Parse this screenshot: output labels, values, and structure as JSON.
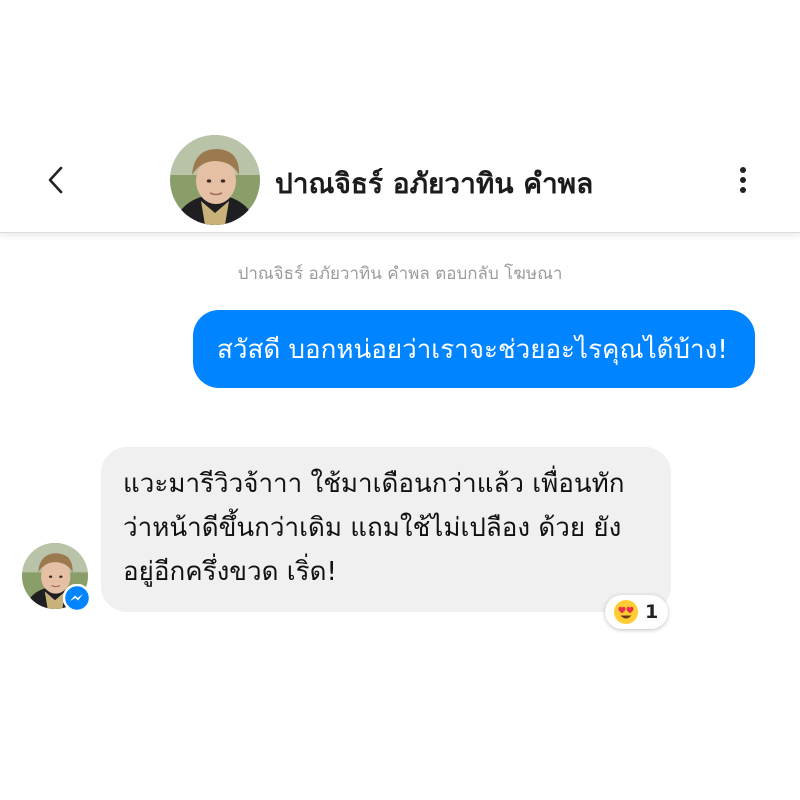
{
  "header": {
    "contact_name": "ปาณจิธร์ อภัยวาทิน คำพล",
    "back_icon": "chevron-left-icon",
    "more_icon": "vertical-dots-icon"
  },
  "conversation": {
    "system_note": "ปาณจิธร์ อภัยวาทิน คำพล ตอบกลับ โฆษณา",
    "outgoing_message": "สวัสดี บอกหน่อยว่าเราจะช่วยอะไรคุณได้บ้าง!",
    "incoming_message": "แวะมารีวิวจ้าาา ใช้มาเดือนกว่าแล้ว เพื่อนทักว่าหน้าดีขึ้นกว่าเดิม แถมใช้ไม่เปลือง ด้วย ยังอยู่อีกครึ่งขวด เริ่ด!",
    "reaction": {
      "emoji": "heart-eyes-emoji",
      "count": "1"
    },
    "badge_icon": "messenger-icon"
  },
  "colors": {
    "outgoing_bubble": "#0084ff",
    "incoming_bubble": "#f0f0f0",
    "system_text": "#9b9b9b",
    "badge": "#0084ff"
  }
}
